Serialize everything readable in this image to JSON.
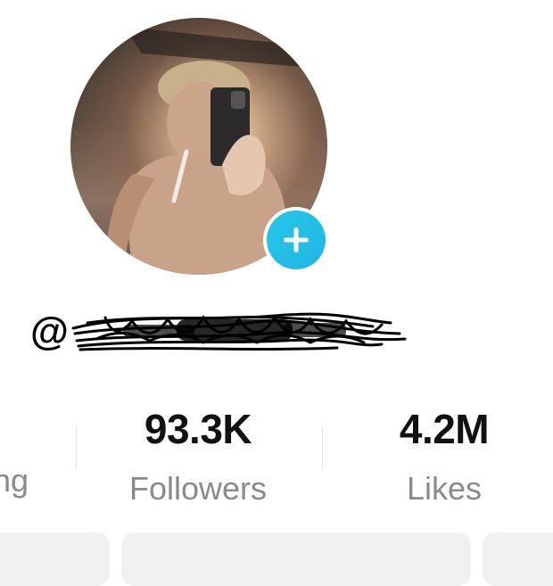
{
  "profile": {
    "avatar_alt": "profile photo",
    "add_icon": "plus-icon",
    "username_prefix": "@"
  },
  "stats": {
    "following_partial": "ng",
    "followers": {
      "value": "93.3K",
      "label": "Followers"
    },
    "likes": {
      "value": "4.2M",
      "label": "Likes"
    }
  },
  "colors": {
    "accent": "#20B5E6",
    "label": "#8A8A8E",
    "pill": "#F1F1F2"
  }
}
